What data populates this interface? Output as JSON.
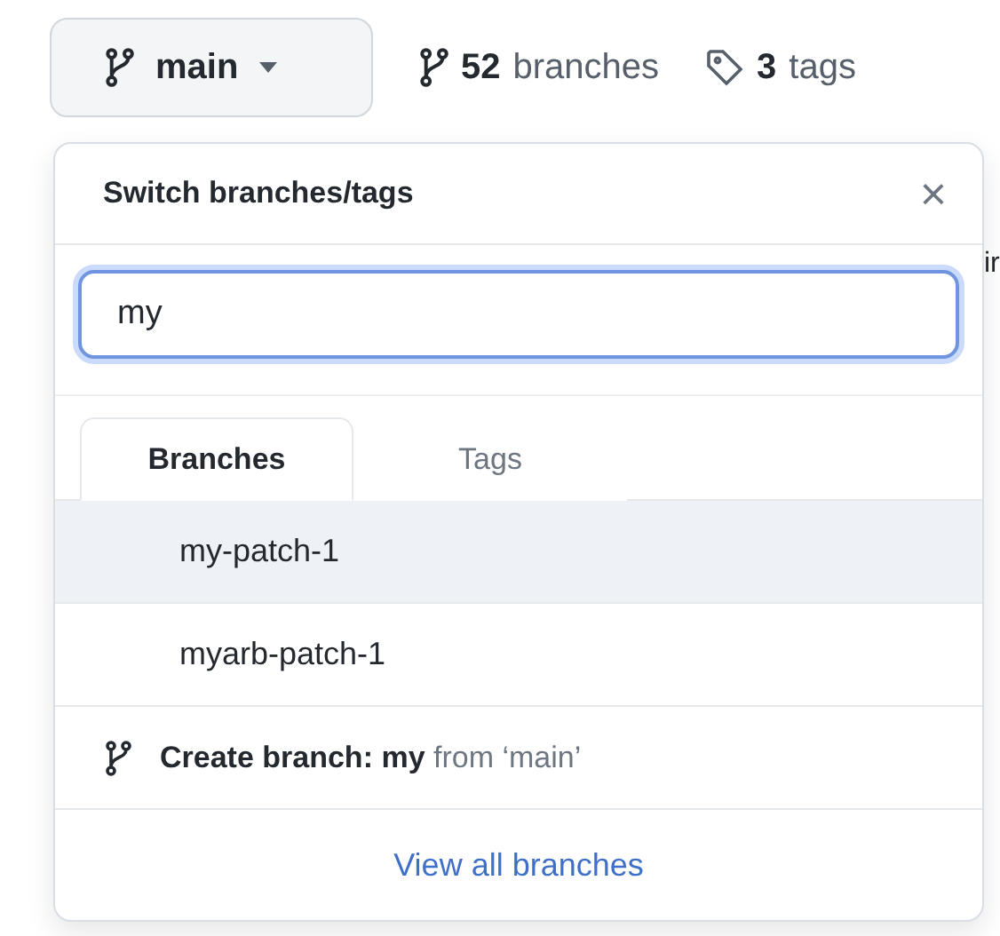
{
  "branch_button": {
    "label": "main"
  },
  "counts": [
    {
      "kind": "branch",
      "number": "52",
      "label": "branches"
    },
    {
      "kind": "tag",
      "number": "3",
      "label": "tags"
    }
  ],
  "background_text": "ir",
  "panel": {
    "title": "Switch branches/tags",
    "close": "×",
    "search": {
      "value": "my"
    },
    "tabs": [
      {
        "label": "Branches",
        "selected": true
      },
      {
        "label": "Tags",
        "selected": false
      }
    ],
    "items": [
      {
        "label": "my-patch-1",
        "selected": true
      },
      {
        "label": "myarb-patch-1",
        "selected": false
      }
    ],
    "create": "**Create branch: my** from ‘main’",
    "footer_link": "View all branches"
  }
}
